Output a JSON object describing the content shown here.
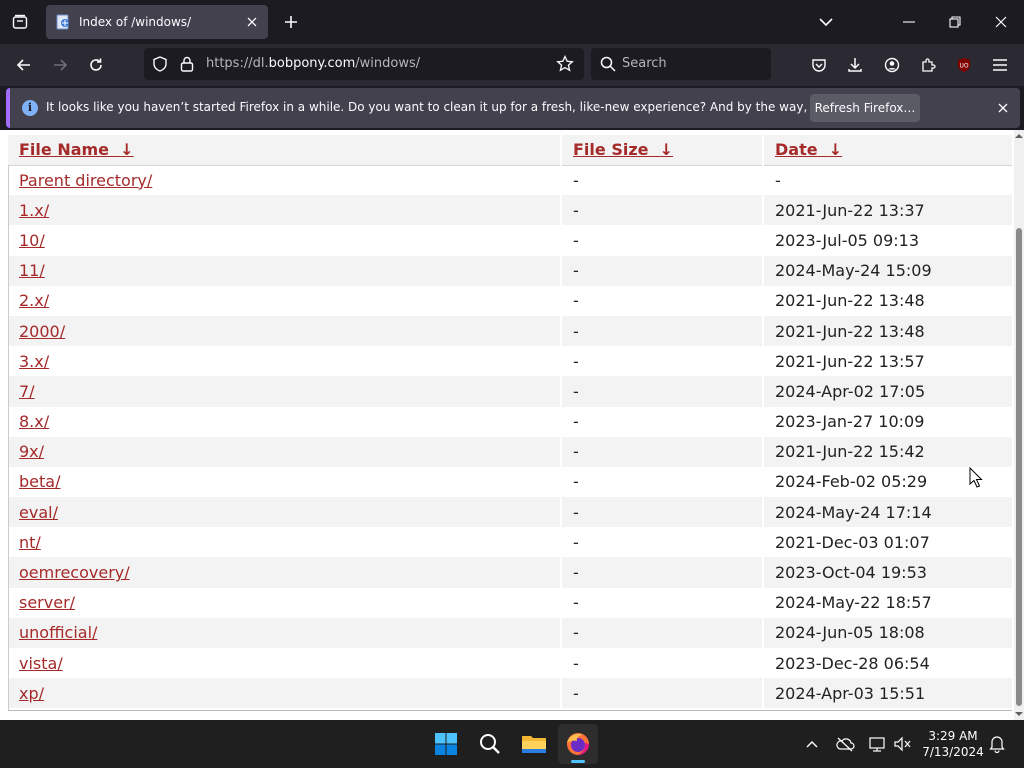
{
  "browser": {
    "tab_title": "Index of /windows/",
    "url_prefix": "https://dl.",
    "url_domain": "bobpony.com",
    "url_path": "/windows/",
    "search_placeholder": "Search"
  },
  "notification": {
    "message": "It looks like you haven’t started Firefox in a while. Do you want to clean it up for a fresh, like-new experience? And by the way, welcome back!",
    "button_label": "Refresh Firefox…"
  },
  "listing": {
    "headers": {
      "name": "File Name",
      "size": "File Size",
      "date": "Date",
      "sort_arrow": "↓"
    },
    "rows": [
      {
        "name": "Parent directory/",
        "size": "-",
        "date": "-"
      },
      {
        "name": "1.x/",
        "size": "-",
        "date": "2021-Jun-22 13:37"
      },
      {
        "name": "10/",
        "size": "-",
        "date": "2023-Jul-05 09:13"
      },
      {
        "name": "11/",
        "size": "-",
        "date": "2024-May-24 15:09"
      },
      {
        "name": "2.x/",
        "size": "-",
        "date": "2021-Jun-22 13:48"
      },
      {
        "name": "2000/",
        "size": "-",
        "date": "2021-Jun-22 13:48"
      },
      {
        "name": "3.x/",
        "size": "-",
        "date": "2021-Jun-22 13:57"
      },
      {
        "name": "7/",
        "size": "-",
        "date": "2024-Apr-02 17:05"
      },
      {
        "name": "8.x/",
        "size": "-",
        "date": "2023-Jan-27 10:09"
      },
      {
        "name": "9x/",
        "size": "-",
        "date": "2021-Jun-22 15:42"
      },
      {
        "name": "beta/",
        "size": "-",
        "date": "2024-Feb-02 05:29"
      },
      {
        "name": "eval/",
        "size": "-",
        "date": "2024-May-24 17:14"
      },
      {
        "name": "nt/",
        "size": "-",
        "date": "2021-Dec-03 01:07"
      },
      {
        "name": "oemrecovery/",
        "size": "-",
        "date": "2023-Oct-04 19:53"
      },
      {
        "name": "server/",
        "size": "-",
        "date": "2024-May-22 18:57"
      },
      {
        "name": "unofficial/",
        "size": "-",
        "date": "2024-Jun-05 18:08"
      },
      {
        "name": "vista/",
        "size": "-",
        "date": "2023-Dec-28 06:54"
      },
      {
        "name": "xp/",
        "size": "-",
        "date": "2024-Apr-03 15:51"
      }
    ]
  },
  "taskbar": {
    "time": "3:29 AM",
    "date": "7/13/2024"
  },
  "icons": {
    "ublock_badge": "UO"
  },
  "colors": {
    "link": "#a52a2a",
    "notification_accent": "#a26dff",
    "browser_dark": "#1c1b22",
    "toolbar": "#2b2a33"
  }
}
